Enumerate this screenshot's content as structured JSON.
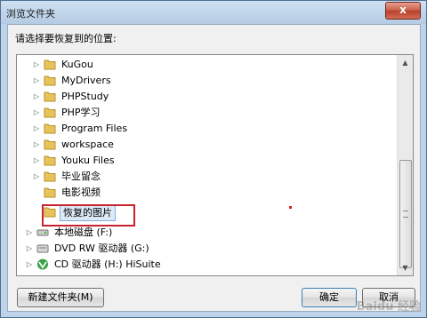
{
  "window": {
    "title": "浏览文件夹",
    "close_label": "x"
  },
  "instruction": "请选择要恢复到的位置:",
  "tree": {
    "items": [
      {
        "label": "KuGou",
        "icon": "folder-icon"
      },
      {
        "label": "MyDrivers",
        "icon": "folder-icon"
      },
      {
        "label": "PHPStudy",
        "icon": "folder-icon"
      },
      {
        "label": "PHP学习",
        "icon": "folder-icon"
      },
      {
        "label": "Program Files",
        "icon": "folder-icon"
      },
      {
        "label": "workspace",
        "icon": "folder-icon"
      },
      {
        "label": "Youku Files",
        "icon": "folder-icon"
      },
      {
        "label": "毕业留念",
        "icon": "folder-icon"
      },
      {
        "label": "电影视频",
        "icon": "folder-icon"
      },
      {
        "label": "恢复的图片",
        "icon": "folder-icon",
        "selected": true
      },
      {
        "label": "本地磁盘 (F:)",
        "icon": "drive-icon"
      },
      {
        "label": "DVD RW 驱动器 (G:)",
        "icon": "dvd-drive-icon"
      },
      {
        "label": "CD 驱动器 (H:) HiSuite",
        "icon": "cd-drive-icon"
      }
    ]
  },
  "buttons": {
    "new_folder": "新建文件夹(M)",
    "ok": "确定",
    "cancel": "取消"
  },
  "watermark": "Baidu 经验",
  "colors": {
    "highlight_box": "#c8232d",
    "selection": "#dceaf7",
    "folder": "#e8c35a"
  }
}
